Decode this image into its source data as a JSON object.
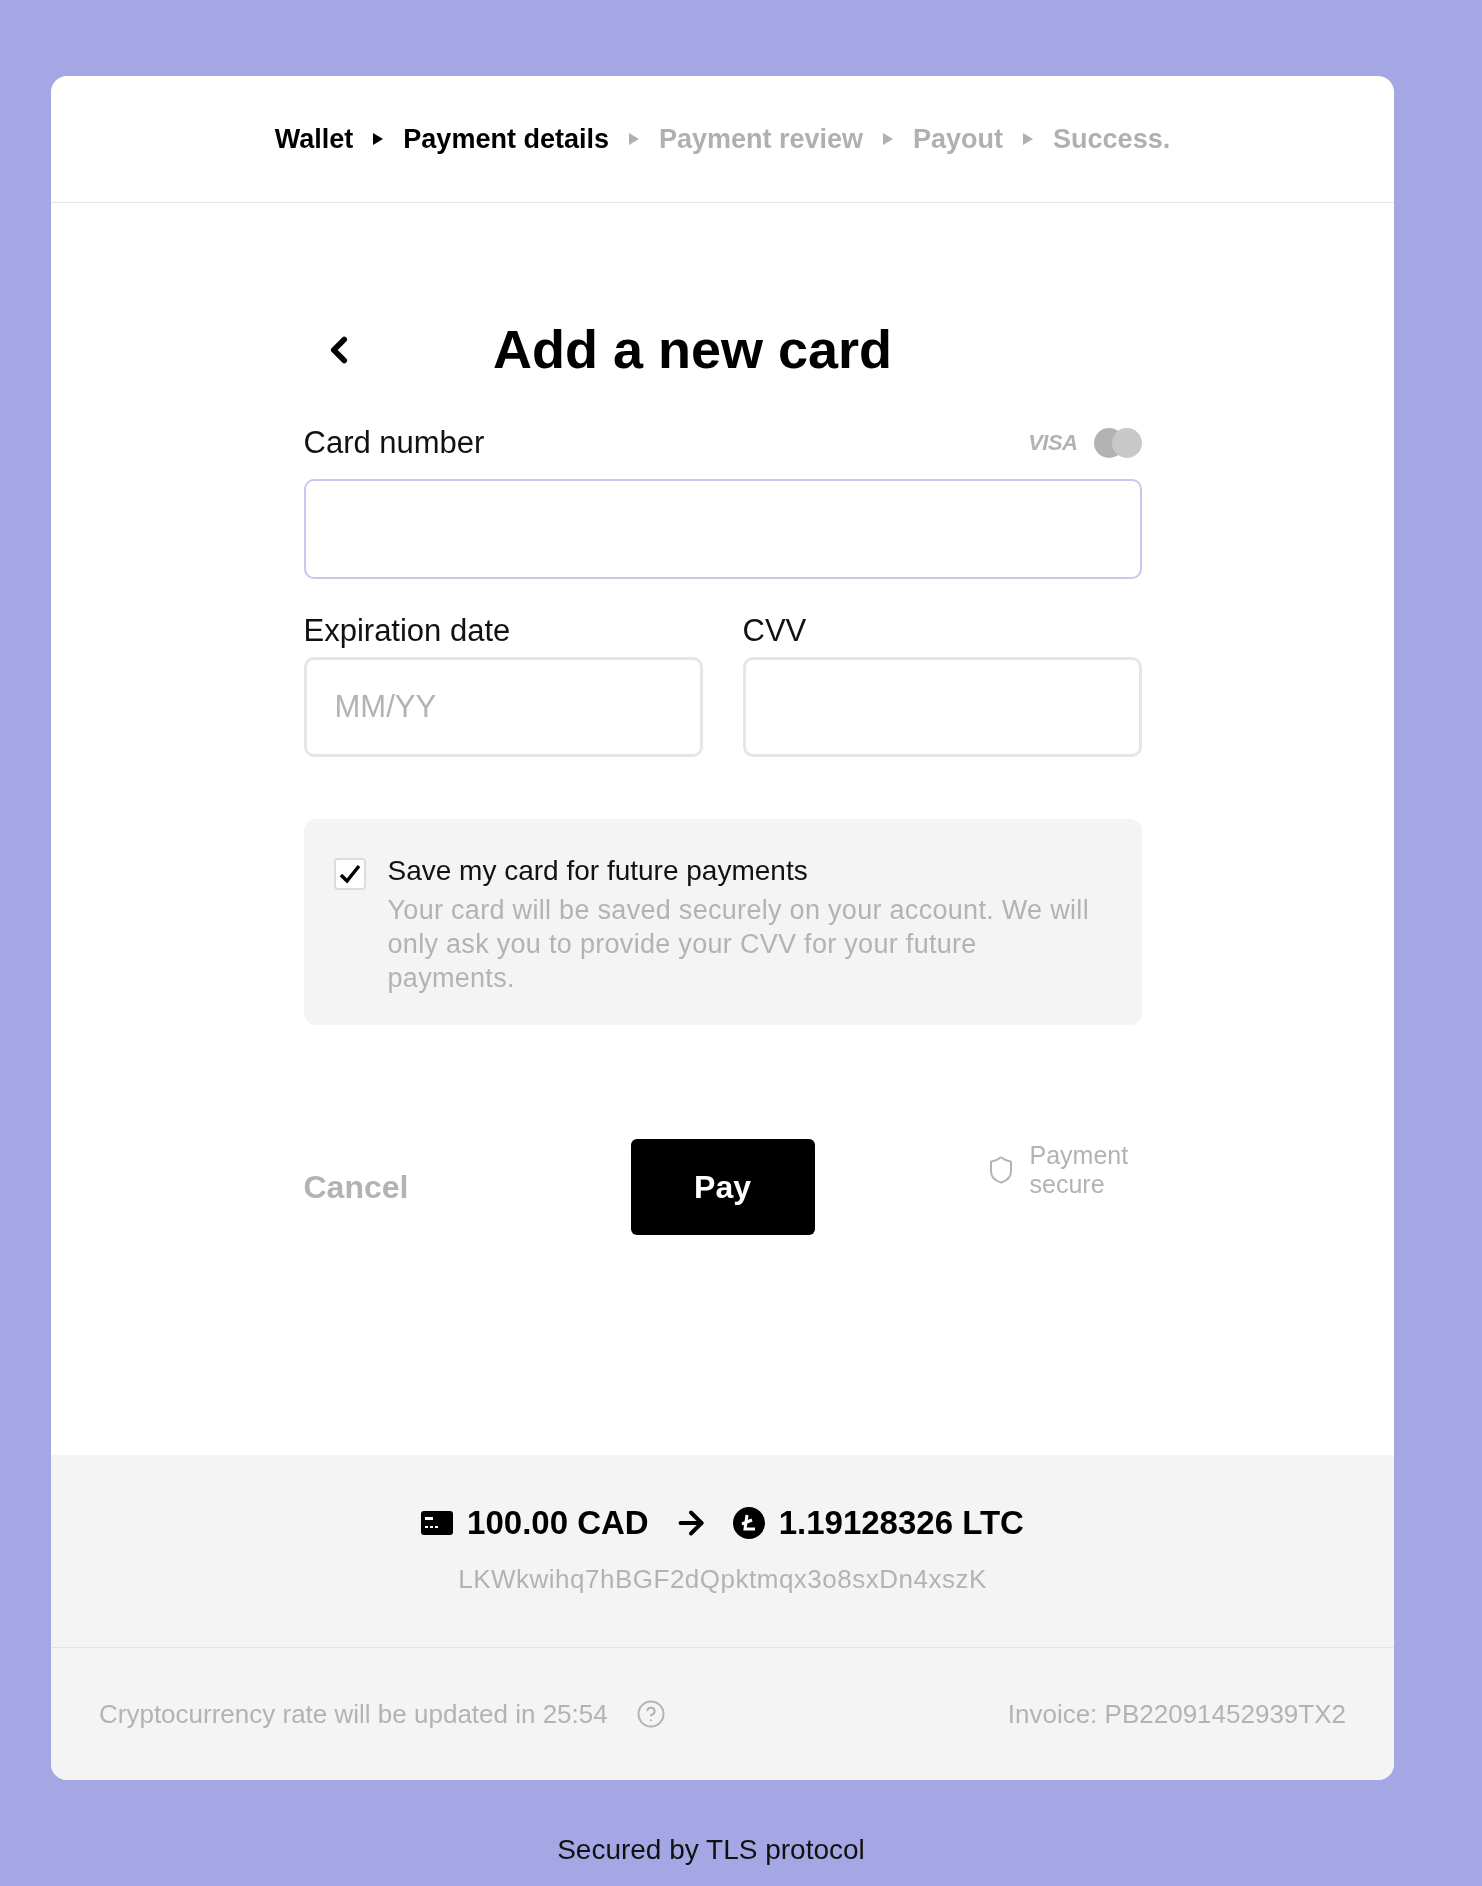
{
  "breadcrumb": [
    {
      "label": "Wallet",
      "active": true
    },
    {
      "label": "Payment details",
      "active": true
    },
    {
      "label": "Payment review",
      "active": false
    },
    {
      "label": "Payout",
      "active": false
    },
    {
      "label": "Success.",
      "active": false
    }
  ],
  "title": "Add a new card",
  "card_brands": {
    "visa": "VISA"
  },
  "fields": [
    {
      "label": "Card number",
      "focused": true
    },
    {
      "label": "Expiration date",
      "placeholder": "MM/YY",
      "focused": false
    },
    {
      "label": "CVV",
      "focused": false
    }
  ],
  "save_card": {
    "checked": true,
    "label": "Save my card for future payments",
    "description": "Your card will be saved securely on your account. We will only ask you to provide your CVV for your future payments."
  },
  "actions": {
    "cancel": "Cancel",
    "pay": "Pay",
    "secure_note": "Payment secure"
  },
  "summary": {
    "fiat_amount": "100.00 CAD",
    "crypto_amount": "1.19128326 LTC",
    "address": "LKWkwihq7hBGF2dQpktmqx3o8sxDn4xszK"
  },
  "footer": {
    "rate_note": "Cryptocurrency rate will be updated in 25:54",
    "invoice": "Invoice: PB22091452939TX2"
  },
  "security_note": "Secured by TLS protocol"
}
